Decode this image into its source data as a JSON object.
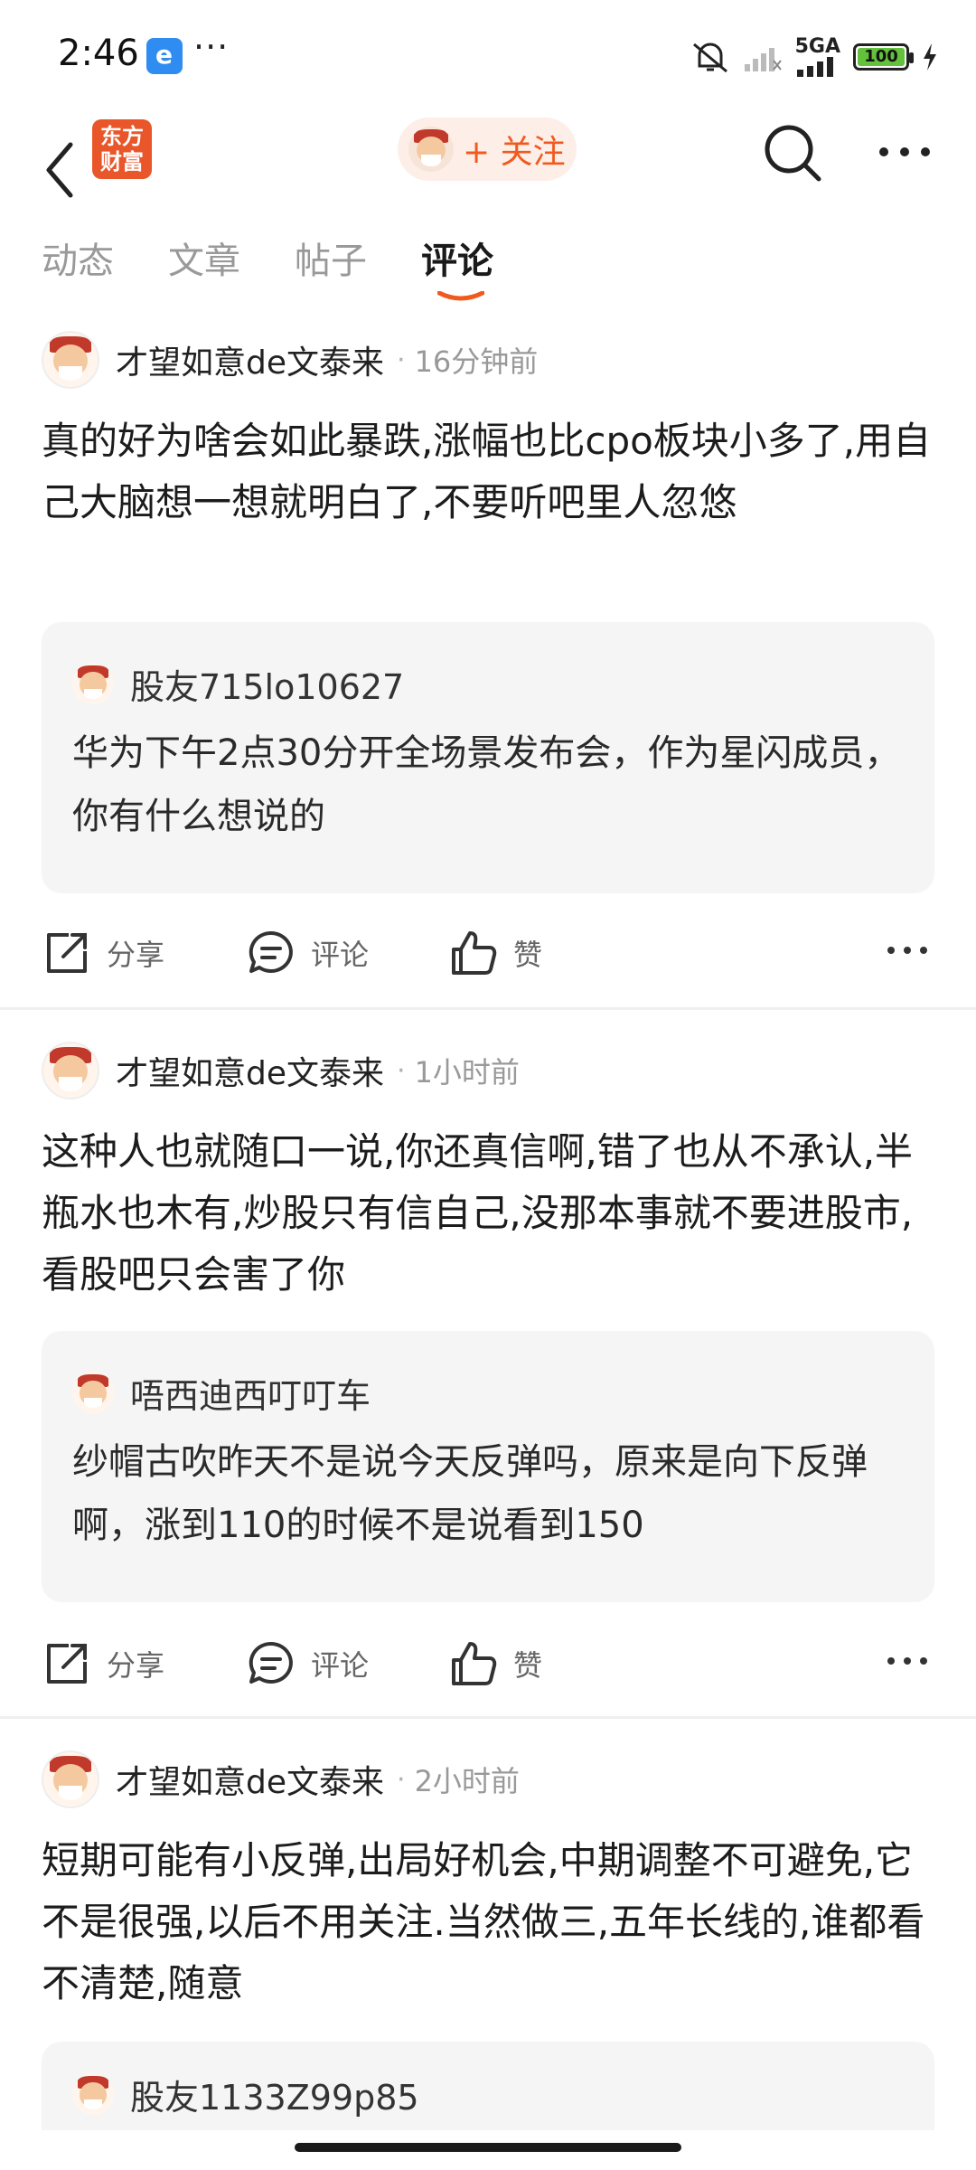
{
  "status_bar": {
    "time": "2:46",
    "overflow": "···",
    "network": "5GA",
    "battery": "100"
  },
  "nav": {
    "logo_line1": "东方",
    "logo_line2": "财富",
    "follow_label": "+ 关注"
  },
  "tabs": [
    {
      "label": "动态",
      "active": false
    },
    {
      "label": "文章",
      "active": false
    },
    {
      "label": "帖子",
      "active": false
    },
    {
      "label": "评论",
      "active": true
    }
  ],
  "actions": {
    "share": "分享",
    "comment": "评论",
    "like": "赞"
  },
  "posts": [
    {
      "author": "才望如意de文泰来",
      "time": "16分钟前",
      "text": "真的好为啥会如此暴跌,涨幅也比cpo板块小多了,用自己大脑想一想就明白了,不要听吧里人忽悠",
      "quote_author": "股友715lo10627",
      "quote_text": "华为下午2点30分开全场景发布会，作为星闪成员，你有什么想说的"
    },
    {
      "author": "才望如意de文泰来",
      "time": "1小时前",
      "text": "这种人也就随口一说,你还真信啊,错了也从不承认,半瓶水也木有,炒股只有信自己,没那本事就不要进股市,看股吧只会害了你",
      "quote_author": "唔西迪西叮叮车",
      "quote_text": "纱帽古吹昨天不是说今天反弹吗，原来是向下反弹啊，涨到110的时候不是说看到150"
    },
    {
      "author": "才望如意de文泰来",
      "time": "2小时前",
      "text": "短期可能有小反弹,出局好机会,中期调整不可避免,它不是很强,以后不用关注.当然做三,五年长线的,谁都看不清楚,随意",
      "quote_author": "股友1133Z99p85",
      "quote_text": ""
    }
  ],
  "colors": {
    "accent": "#f05a1e",
    "logo_bg": "#e8562a",
    "battery_fill": "#63c13c"
  }
}
